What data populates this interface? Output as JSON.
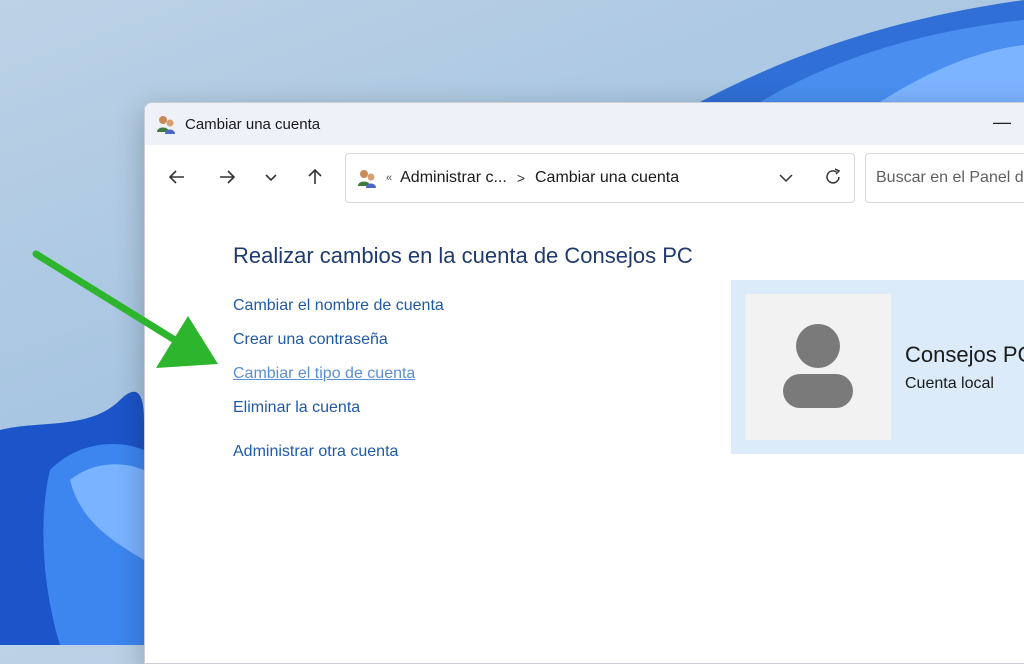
{
  "window": {
    "title": "Cambiar una cuenta",
    "minimize_label": "—"
  },
  "toolbar": {
    "breadcrumb_overflow": "«",
    "breadcrumb": [
      "Administrar c...",
      "Cambiar una cuenta"
    ],
    "breadcrumb_separator": ">",
    "search_placeholder": "Buscar en el Panel de control"
  },
  "main": {
    "heading": "Realizar cambios en la cuenta de Consejos PC",
    "tasks": [
      "Cambiar el nombre de cuenta",
      "Crear una contraseña",
      "Cambiar el tipo de cuenta",
      "Eliminar la cuenta"
    ],
    "other_link": "Administrar otra cuenta"
  },
  "account": {
    "name": "Consejos PC",
    "type": "Cuenta local"
  },
  "colors": {
    "link": "#1f5aa6",
    "link_hover": "#5b8fd1",
    "heading": "#1e3a6e",
    "card_bg": "#dcebf9",
    "annotation_arrow": "#2db52d"
  }
}
